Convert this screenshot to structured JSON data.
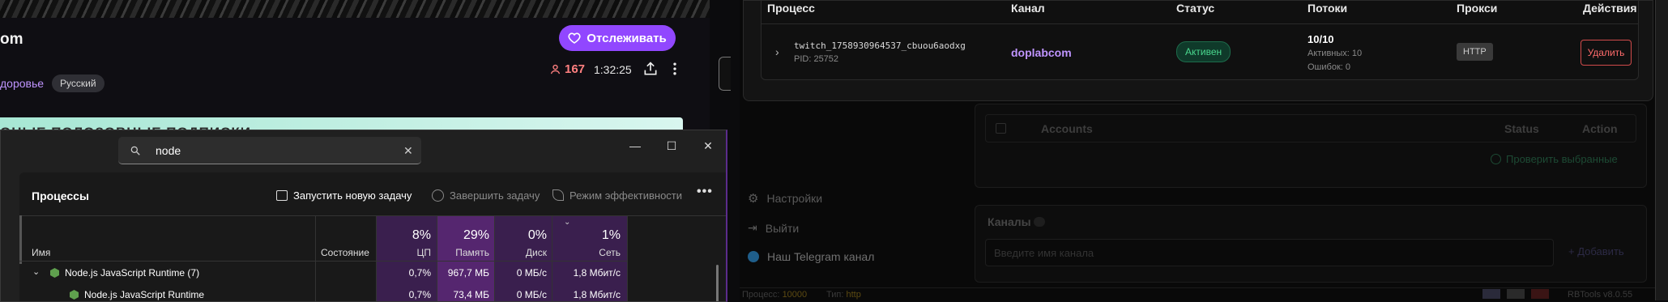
{
  "stream": {
    "title": "om",
    "follow_label": "Отслеживать",
    "category": "доровье",
    "language_tag": "Русский",
    "viewers": "167",
    "uptime": "1:32:25",
    "banner_text": "ОНЫЕ ПОЛОЗОВНЫЕ ПОДПИСКИ"
  },
  "taskmgr": {
    "search_value": "node",
    "heading": "Процессы",
    "run_task": "Запустить новую задачу",
    "end_task": "Завершить задачу",
    "efficiency": "Режим эффективности",
    "columns": {
      "name": "Имя",
      "status": "Состояние",
      "cpu_pct": "8%",
      "cpu": "ЦП",
      "mem_pct": "29%",
      "mem": "Память",
      "disk_pct": "0%",
      "disk": "Диск",
      "net_pct": "1%",
      "net": "Сеть"
    },
    "rows": [
      {
        "name": "Node.js JavaScript Runtime (7)",
        "cpu": "0,7%",
        "mem": "967,7 МБ",
        "disk": "0 МБ/с",
        "net": "1,8 Мбит/с"
      },
      {
        "name": "Node.js JavaScript Runtime",
        "cpu": "0,7%",
        "mem": "73,4 МБ",
        "disk": "0 МБ/с",
        "net": "1,8 Мбит/с"
      }
    ]
  },
  "processes": {
    "headers": {
      "process": "Процесс",
      "channel": "Канал",
      "status": "Статус",
      "threads": "Потоки",
      "proxy": "Прокси",
      "actions": "Действия"
    },
    "row": {
      "name": "twitch_1758930964537_cbuou6aodxg",
      "pid": "PID: 25752",
      "channel": "doplabcom",
      "status": "Активен",
      "threads": "10/10",
      "active": "Активных: 10",
      "errors": "Ошибок: 0",
      "proxy": "HTTP",
      "delete": "Удалить"
    }
  },
  "accounts": {
    "col_accounts": "Accounts",
    "col_status": "Status",
    "col_action": "Action",
    "check_selected": "Проверить выбранные"
  },
  "sidebar": {
    "settings": "Настройки",
    "logout": "Выйти",
    "telegram": "Наш Telegram канал"
  },
  "channels": {
    "title": "Каналы",
    "input_placeholder": "Введите имя канала",
    "add": "Добавить"
  },
  "statusbar": {
    "processes_label": "Процесс:",
    "processes_value": "10000",
    "type_label": "Тип:",
    "type_value": "http",
    "version": "RBTools v8.0.55"
  },
  "colors": {
    "accent": "#9147ff",
    "channel": "#bf94ff",
    "active_green": "#4ad98f",
    "danger": "#ff6b6b"
  }
}
